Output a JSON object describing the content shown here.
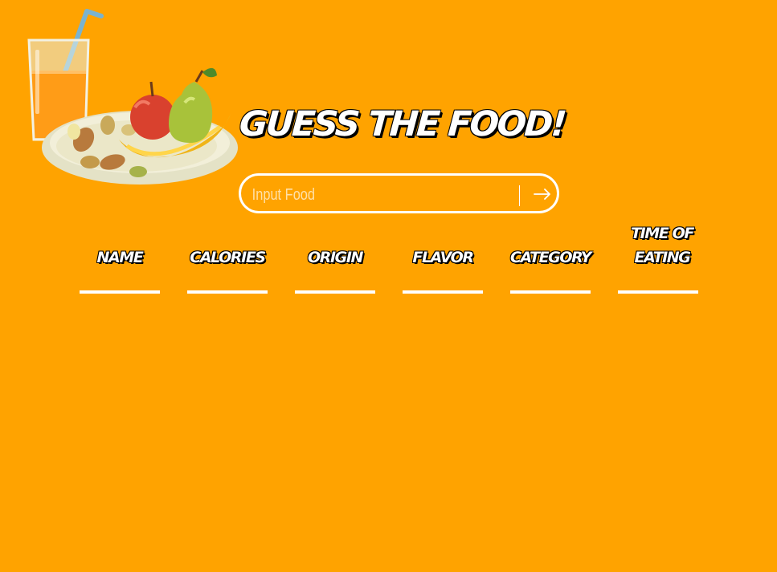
{
  "header": {
    "title": "GUESS THE FOOD!"
  },
  "search": {
    "placeholder": "Input Food",
    "value": "",
    "submit_icon": "arrow-right-icon"
  },
  "columns": [
    {
      "label": "NAME"
    },
    {
      "label": "CALORIES"
    },
    {
      "label": "ORIGIN"
    },
    {
      "label": "FLAVOR"
    },
    {
      "label": "CATEGORY"
    },
    {
      "label": "TIME OF EATING"
    }
  ],
  "illustration": {
    "icon": "food-plate-juice-icon"
  },
  "colors": {
    "background": "#ffa300",
    "foreground": "#ffffff",
    "outline": "#000000"
  }
}
